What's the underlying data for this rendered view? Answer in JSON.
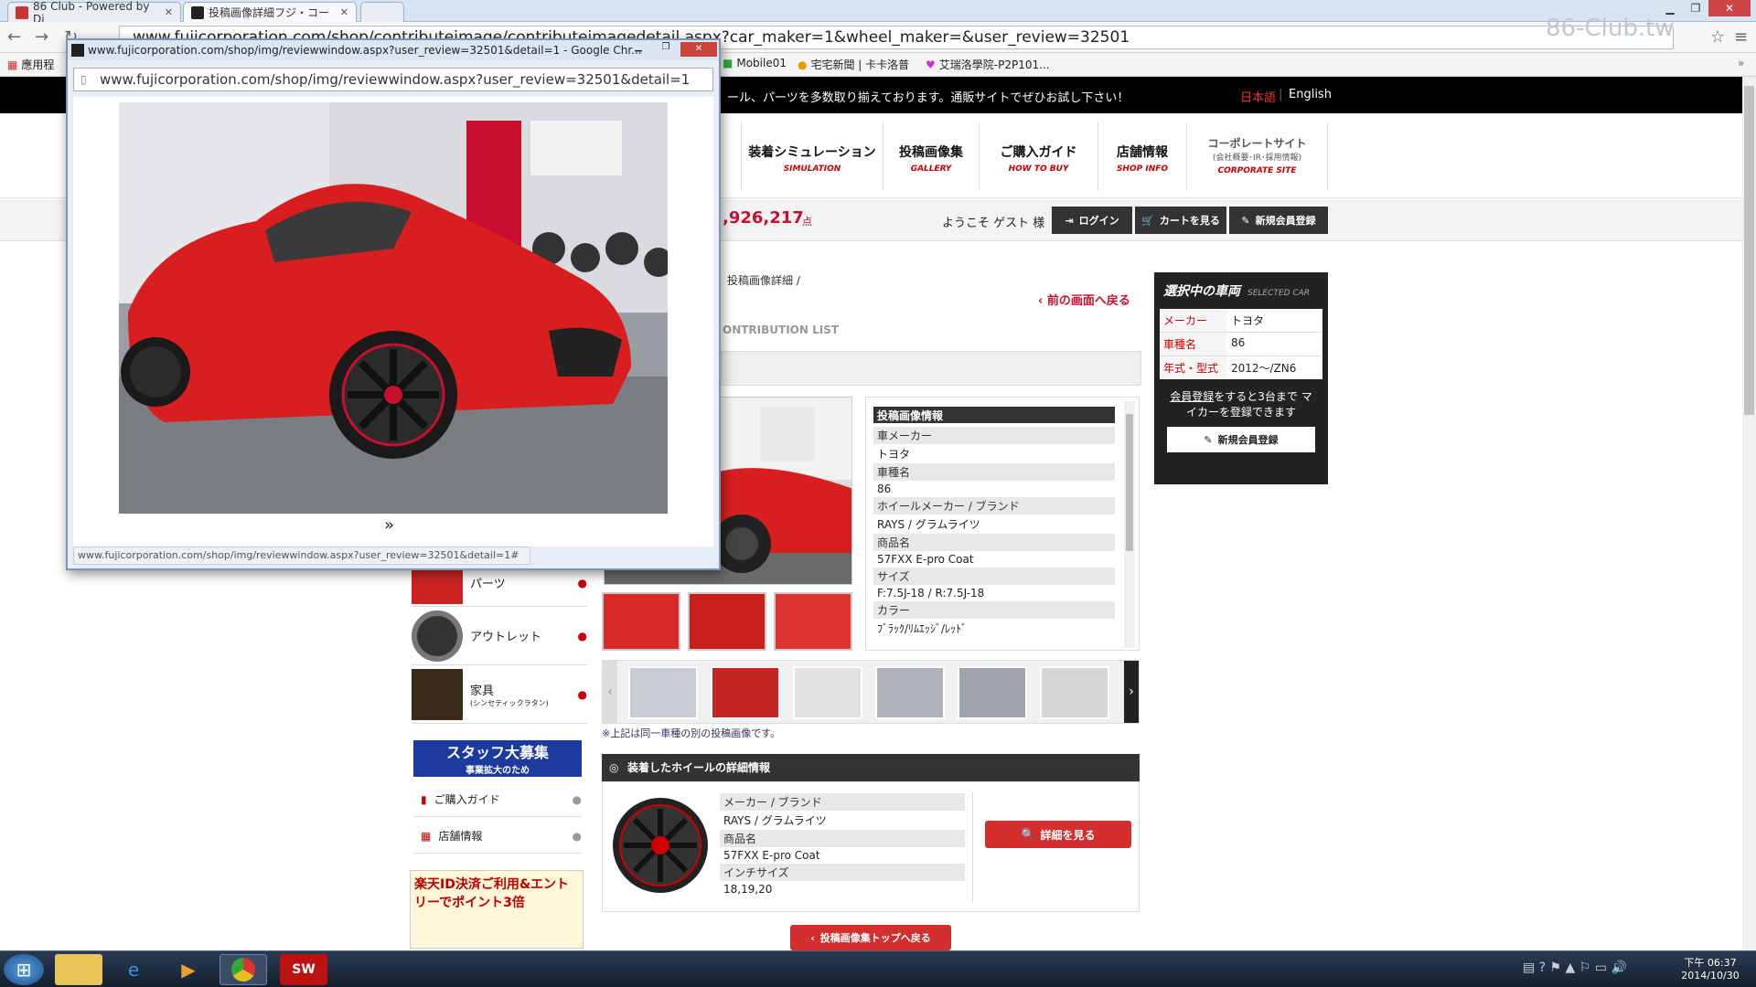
{
  "browser": {
    "tabs": [
      {
        "label": "86 Club - Powered by Di",
        "active": false
      },
      {
        "label": "投稿画像詳細フジ・コー",
        "active": true
      }
    ],
    "url": "www.fujicorporation.com/shop/contributeimage/contributeimagedetail.aspx?car_maker=1&wheel_maker=&user_review=32501",
    "watermark": "86-Club.tw",
    "bookmarks": [
      "應用程",
      "Mobile01",
      "宅宅新聞 | 卡卡洛普",
      "艾瑞洛學院-P2P101..."
    ]
  },
  "site": {
    "announcement": "ール、パーツを多数取り揃えております。通販サイトでぜひお試し下さい！",
    "lang_jp": "日本語",
    "lang_en": "English",
    "nav": [
      {
        "jp": "装着シミュレーション",
        "en": "SIMULATION"
      },
      {
        "jp": "投稿画像集",
        "en": "GALLERY"
      },
      {
        "jp": "ご購入ガイド",
        "en": "HOW TO BUY"
      },
      {
        "jp": "店舗情報",
        "en": "SHOP INFO"
      },
      {
        "jp": "コーポレートサイト",
        "sub": "(会社概要･IR･採用情報)",
        "en": "CORPORATE SITE"
      }
    ],
    "points": ",926,217",
    "points_unit": "点",
    "welcome": "ようこそ ゲスト 様",
    "login": "ログイン",
    "cart": "カートを見る",
    "register": "新規会員登録"
  },
  "page": {
    "breadcrumb_tail": "投稿画像詳細 /",
    "back_link": "前の画面へ戻る",
    "list_title": "ONTRIBUTION LIST",
    "info_header": "投稿画像情報",
    "info": [
      {
        "label": "車メーカー",
        "value": "トヨタ"
      },
      {
        "label": "車種名",
        "value": "86"
      },
      {
        "label": "ホイールメーカー / ブランド",
        "value": "RAYS / グラムライツ"
      },
      {
        "label": "商品名",
        "value": "57FXX E-pro Coat"
      },
      {
        "label": "サイズ",
        "value": "F:7.5J-18 / R:7.5J-18"
      },
      {
        "label": "カラー",
        "value": "ﾌﾞﾗｯｸ/ﾘﾑｴｯｼﾞ/ﾚｯﾄﾞ"
      }
    ],
    "same_car_note": "※上記は同一車種の別の投稿画像です。",
    "wheel_title": "装着したホイールの詳細情報",
    "wheel": [
      {
        "label": "メーカー / ブランド",
        "value": "RAYS / グラムライツ"
      },
      {
        "label": "商品名",
        "value": "57FXX E-pro Coat"
      },
      {
        "label": "インチサイズ",
        "value": "18,19,20"
      }
    ],
    "detail_btn": "詳細を見る",
    "top_btn": "投稿画像集トップへ戻る"
  },
  "sidebar": {
    "categories": [
      {
        "label": "パーツ"
      },
      {
        "label": "アウトレット"
      },
      {
        "label": "家具",
        "sub": "(シンセティックラタン)"
      }
    ],
    "staff_banner": "スタッフ大募集",
    "staff_sub": "事業拡大のため",
    "links": [
      {
        "label": "ご購入ガイド"
      },
      {
        "label": "店舗情報"
      }
    ],
    "rakuten": "楽天ID決済ご利用&エントリーでポイント3倍"
  },
  "selected_car": {
    "title": "選択中の車両",
    "title_en": "SELECTED CAR",
    "rows": [
      {
        "label": "メーカー",
        "value": "トヨタ"
      },
      {
        "label": "車種名",
        "value": "86"
      },
      {
        "label": "年式・型式",
        "value": "2012～/ZN6"
      }
    ],
    "note_link": "会員登録",
    "note": "をすると3台まで マイカーを登録できます",
    "register": "新規会員登録"
  },
  "popup": {
    "title": "www.fujicorporation.com/shop/img/reviewwindow.aspx?user_review=32501&detail=1 - Google Chr...",
    "url": "www.fujicorporation.com/shop/img/reviewwindow.aspx?user_review=32501&detail=1",
    "next": "»",
    "status": "www.fujicorporation.com/shop/img/reviewwindow.aspx?user_review=32501&detail=1#"
  },
  "taskbar": {
    "time": "下午 06:37",
    "date": "2014/10/30"
  },
  "colors": {
    "brand_red": "#c8102e",
    "header_black": "#000000",
    "car_red": "#d81e1e"
  }
}
